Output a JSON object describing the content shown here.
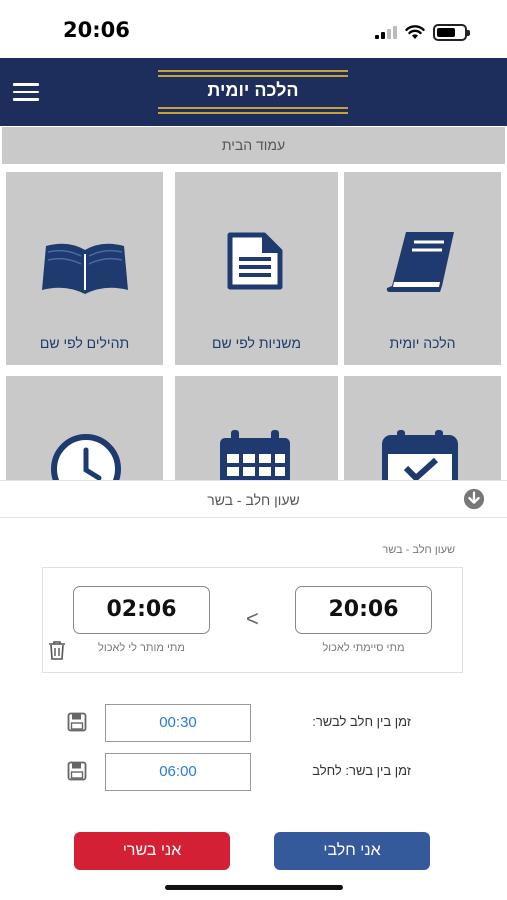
{
  "status_bar": {
    "time": "20:06"
  },
  "header": {
    "title": "הלכה יומית"
  },
  "home_strip": {
    "label": "עמוד הבית"
  },
  "tiles": [
    {
      "label": "הלכה יומית",
      "icon": "book-icon"
    },
    {
      "label": "משניות לפי שם",
      "icon": "document-icon"
    },
    {
      "label": "תהילים לפי שם",
      "icon": "open-book-icon"
    },
    {
      "label": "",
      "icon": "calendar-check-icon"
    },
    {
      "label": "",
      "icon": "calendar-icon"
    },
    {
      "label": "",
      "icon": "clock-icon"
    }
  ],
  "sheet": {
    "title": "שעון חלב - בשר",
    "section_label": "שעון חלב - בשר",
    "finished_time": "20:06",
    "finished_caption": "מתי סיימתי לאכול",
    "allowed_time": "02:06",
    "allowed_caption": "מתי מותר לי לאכול",
    "arrow": "<",
    "rows": [
      {
        "label": "זמן בין חלב לבשר:",
        "value": "00:30"
      },
      {
        "label": "זמן בין בשר: לחלב",
        "value": "06:00"
      }
    ],
    "buttons": {
      "dairy": "אני חלבי",
      "meat": "אני בשרי"
    }
  },
  "colors": {
    "header_bg": "#1d2d5c",
    "accent_gold": "#c9a13c",
    "tile_bg": "#c9c9c9",
    "icon_blue": "#1f3a6e",
    "meat_red": "#d42035",
    "dairy_blue": "#355a9c",
    "value_blue": "#2a7ad4"
  }
}
